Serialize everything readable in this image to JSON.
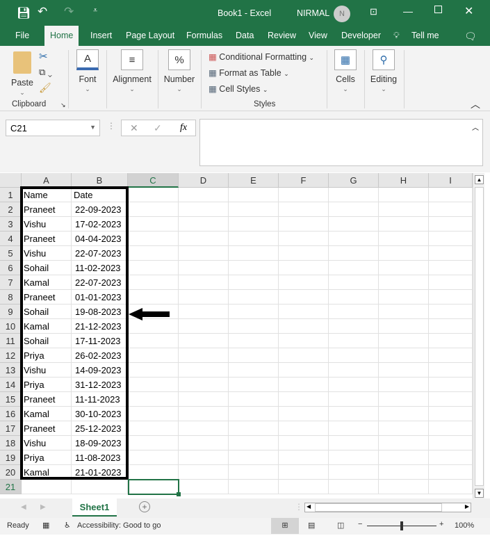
{
  "titlebar": {
    "title": "Book1  -  Excel",
    "user": "NIRMAL",
    "avatar": "N"
  },
  "tabs": [
    "File",
    "Home",
    "Insert",
    "Page Layout",
    "Formulas",
    "Data",
    "Review",
    "View",
    "Developer",
    "Tell me"
  ],
  "ribbon": {
    "paste": "Paste",
    "clipboard": "Clipboard",
    "font": "Font",
    "alignment": "Alignment",
    "number": "Number",
    "conditional": "Conditional Formatting",
    "format_table": "Format as Table",
    "cell_styles": "Cell Styles",
    "styles": "Styles",
    "cells": "Cells",
    "editing": "Editing"
  },
  "formula": {
    "name_box": "C21",
    "fx": "fx",
    "value": ""
  },
  "columns": [
    "A",
    "B",
    "C",
    "D",
    "E",
    "F",
    "G",
    "H",
    "I"
  ],
  "rows": [
    [
      "Name",
      "Date"
    ],
    [
      "Praneet",
      "22-09-2023"
    ],
    [
      "Vishu",
      "17-02-2023"
    ],
    [
      "Praneet",
      "04-04-2023"
    ],
    [
      "Vishu",
      "22-07-2023"
    ],
    [
      "Sohail",
      "11-02-2023"
    ],
    [
      "Kamal",
      "22-07-2023"
    ],
    [
      "Praneet",
      "01-01-2023"
    ],
    [
      "Sohail",
      "19-08-2023"
    ],
    [
      "Kamal",
      "21-12-2023"
    ],
    [
      "Sohail",
      "17-11-2023"
    ],
    [
      "Priya",
      "26-02-2023"
    ],
    [
      "Vishu",
      "14-09-2023"
    ],
    [
      "Priya",
      "31-12-2023"
    ],
    [
      "Praneet",
      "11-11-2023"
    ],
    [
      "Kamal",
      "30-10-2023"
    ],
    [
      "Praneet",
      "25-12-2023"
    ],
    [
      "Vishu",
      "18-09-2023"
    ],
    [
      "Priya",
      "11-08-2023"
    ],
    [
      "Kamal",
      "21-01-2023"
    ],
    [
      "",
      ""
    ]
  ],
  "sheet_tab": "Sheet1",
  "status": {
    "ready": "Ready",
    "accessibility": "Accessibility: Good to go",
    "zoom": "100%"
  }
}
